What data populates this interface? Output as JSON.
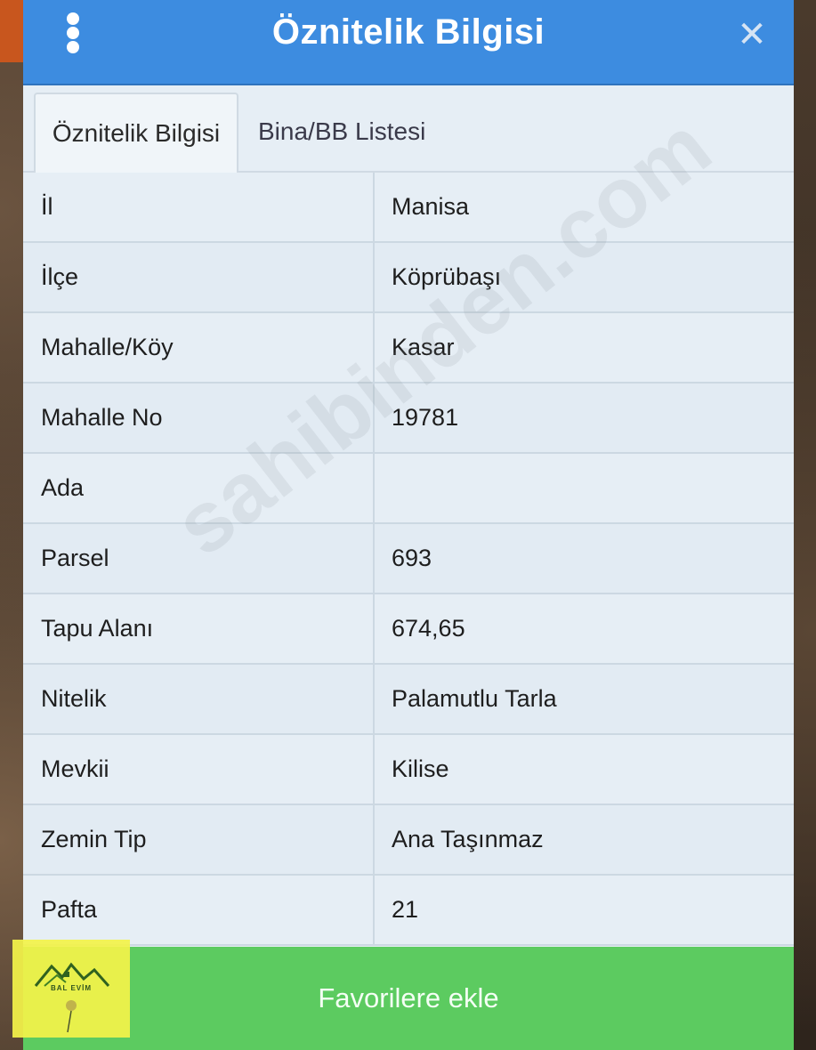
{
  "dialog": {
    "title": "Öznitelik Bilgisi",
    "close_symbol": "✕"
  },
  "tabs": [
    {
      "label": "Öznitelik Bilgisi",
      "active": true
    },
    {
      "label": "Bina/BB Listesi",
      "active": false
    }
  ],
  "rows": [
    {
      "label": "İl",
      "value": "Manisa"
    },
    {
      "label": "İlçe",
      "value": "Köprübaşı"
    },
    {
      "label": "Mahalle/Köy",
      "value": "Kasar"
    },
    {
      "label": "Mahalle No",
      "value": "19781"
    },
    {
      "label": "Ada",
      "value": ""
    },
    {
      "label": "Parsel",
      "value": "693"
    },
    {
      "label": "Tapu Alanı",
      "value": "674,65"
    },
    {
      "label": "Nitelik",
      "value": "Palamutlu Tarla"
    },
    {
      "label": "Mevkii",
      "value": "Kilise"
    },
    {
      "label": "Zemin Tip",
      "value": "Ana Taşınmaz"
    },
    {
      "label": "Pafta",
      "value": "21"
    }
  ],
  "footer": {
    "favorite_label": "Favorilere ekle"
  },
  "logo": {
    "text": "BAL EVİM"
  },
  "watermark": {
    "text": "sahibinden.com"
  },
  "colors": {
    "titlebar": "#3d8ce0",
    "footer_button": "#5ccb60",
    "logo_bg": "#f4f44a"
  },
  "icons": [
    "menu-kebab-icon",
    "close-icon"
  ]
}
